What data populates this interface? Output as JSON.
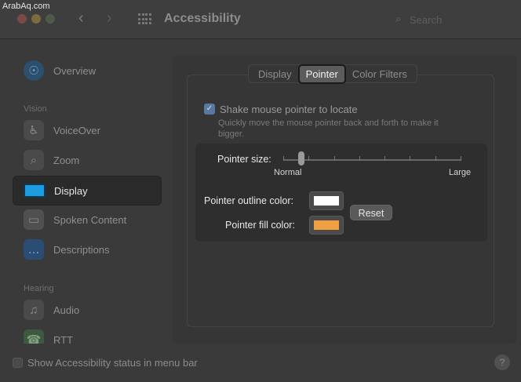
{
  "watermark": "ArabAq.com",
  "window": {
    "title": "Accessibility",
    "search_placeholder": "Search"
  },
  "sidebar": {
    "items": [
      {
        "label": "Overview",
        "icon": "overview-icon"
      },
      {
        "label": "VoiceOver",
        "icon": "voiceover-icon"
      },
      {
        "label": "Zoom",
        "icon": "zoom-icon"
      },
      {
        "label": "Display",
        "icon": "display-icon",
        "selected": true
      },
      {
        "label": "Spoken Content",
        "icon": "spoken-content-icon"
      },
      {
        "label": "Descriptions",
        "icon": "descriptions-icon"
      },
      {
        "label": "Audio",
        "icon": "audio-icon"
      },
      {
        "label": "RTT",
        "icon": "rtt-icon"
      }
    ],
    "sections": {
      "vision": "Vision",
      "hearing": "Hearing"
    }
  },
  "tabs": [
    {
      "label": "Display"
    },
    {
      "label": "Pointer",
      "selected": true
    },
    {
      "label": "Color Filters"
    }
  ],
  "pointer": {
    "shake_label": "Shake mouse pointer to locate",
    "shake_checked": true,
    "shake_description": "Quickly move the mouse pointer back and forth to make it bigger.",
    "size_label": "Pointer size:",
    "size_min_label": "Normal",
    "size_max_label": "Large",
    "size_value_fraction": 0.1,
    "outline_label": "Pointer outline color:",
    "outline_color": "#ffffff",
    "fill_label": "Pointer fill color:",
    "fill_color": "#f0a040",
    "reset_label": "Reset"
  },
  "footer": {
    "status_label": "Show Accessibility status in menu bar",
    "status_checked": false,
    "help_label": "?"
  }
}
